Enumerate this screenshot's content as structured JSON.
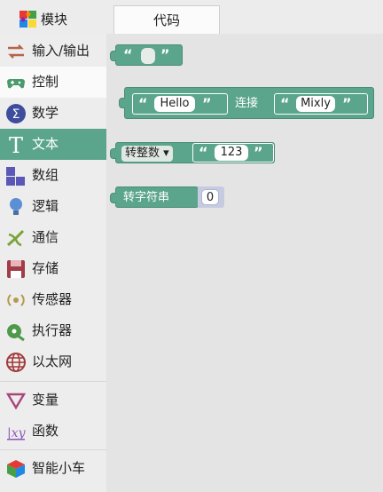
{
  "tabs": {
    "modules": "模块",
    "code": "代码"
  },
  "categories": [
    {
      "label": "输入/输出",
      "icon": "arrows-icon"
    },
    {
      "label": "控制",
      "icon": "gamepad-icon"
    },
    {
      "label": "数学",
      "icon": "sigma-icon"
    },
    {
      "label": "文本",
      "icon": "text-t-icon"
    },
    {
      "label": "数组",
      "icon": "blocks-icon"
    },
    {
      "label": "逻辑",
      "icon": "bulb-icon"
    },
    {
      "label": "通信",
      "icon": "antenna-icon"
    },
    {
      "label": "存储",
      "icon": "floppy-icon"
    },
    {
      "label": "传感器",
      "icon": "sensor-icon"
    },
    {
      "label": "执行器",
      "icon": "actuator-icon"
    },
    {
      "label": "以太网",
      "icon": "globe-icon"
    },
    {
      "label": "变量",
      "icon": "variable-icon"
    },
    {
      "label": "函数",
      "icon": "function-icon"
    },
    {
      "label": "智能小车",
      "icon": "cube-icon"
    }
  ],
  "blocks": {
    "empty_text": {
      "open_quote": "“",
      "close_quote": "”",
      "value": ""
    },
    "join": {
      "label": "连接",
      "left_value": "Hello",
      "right_value": "Mixly",
      "open_quote": "“",
      "close_quote": "”"
    },
    "convert": {
      "dropdown": "转整数",
      "value": "123",
      "open_quote": "“",
      "close_quote": "”"
    },
    "to_string": {
      "label": "转字符串",
      "value": "0"
    }
  },
  "colors": {
    "text_category": "#5ba58c",
    "block": "#5ba58c"
  }
}
